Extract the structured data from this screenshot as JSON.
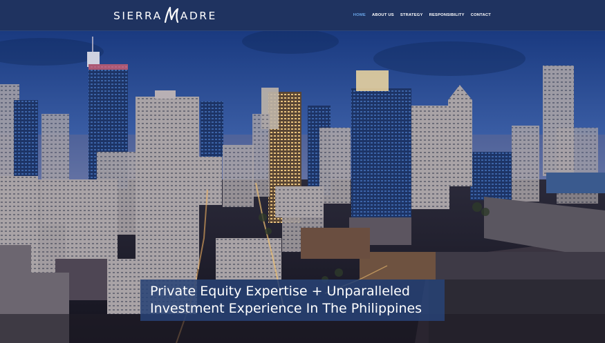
{
  "brand": {
    "part1": "SIERRA",
    "part2": "ADRE",
    "logo_icon": "sierra-madre-m-icon"
  },
  "nav": {
    "items": [
      {
        "label": "HOME",
        "active": true
      },
      {
        "label": "ABOUT US",
        "active": false
      },
      {
        "label": "STRATEGY",
        "active": false
      },
      {
        "label": "RESPONSIBILITY",
        "active": false
      },
      {
        "label": "CONTACT",
        "active": false
      }
    ],
    "active_color": "#6aa6e8"
  },
  "hero": {
    "headline_line1": "Private Equity Expertise + Unparalleled",
    "headline_line2": "Investment Experience In The Philippines",
    "image_subject": "city-skyline-at-dusk"
  },
  "colors": {
    "header_bg": "#1f3360",
    "headline_bg": "#284276",
    "sky_top": "#1c3f86",
    "sky_bottom": "#6d86bd"
  }
}
